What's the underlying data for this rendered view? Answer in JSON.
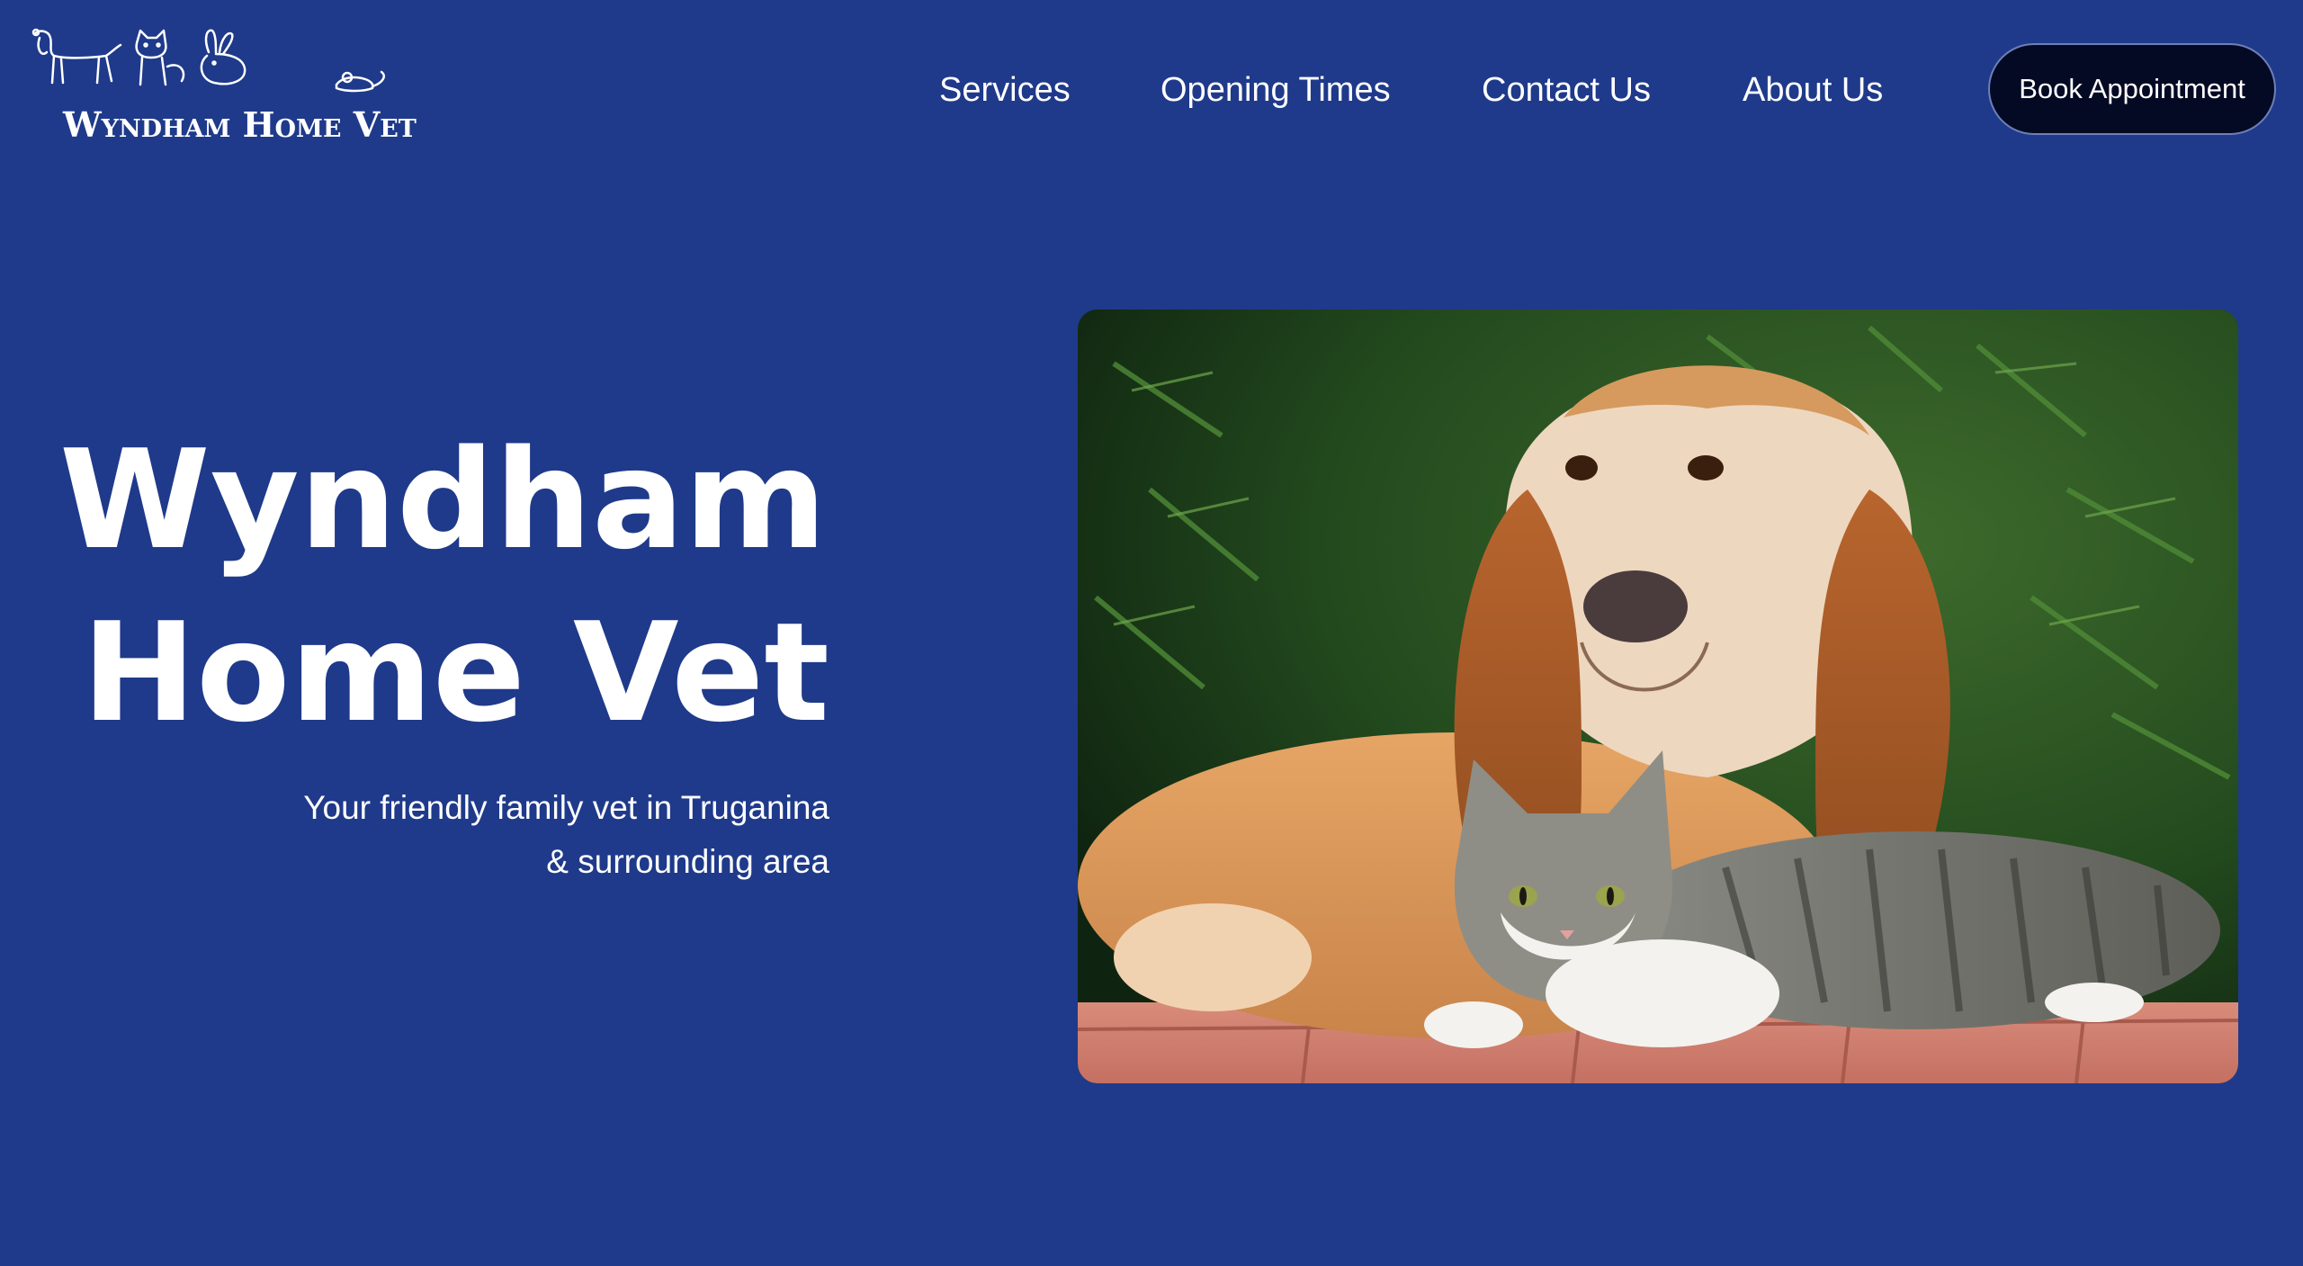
{
  "header": {
    "logo_text": "Wyndham Home Vet",
    "nav": [
      "Services",
      "Opening Times",
      "Contact Us",
      "About Us"
    ],
    "cta": "Book Appointment"
  },
  "hero": {
    "title_line1": "Wyndham",
    "title_line2": "Home Vet",
    "subtitle_line1": "Your friendly family vet in Truganina",
    "subtitle_line2": "& surrounding area",
    "image": "basset-hound-and-tabby-cat-photo"
  },
  "colors": {
    "background": "#1f3a8a",
    "button": "#050a24",
    "text": "#ffffff"
  }
}
